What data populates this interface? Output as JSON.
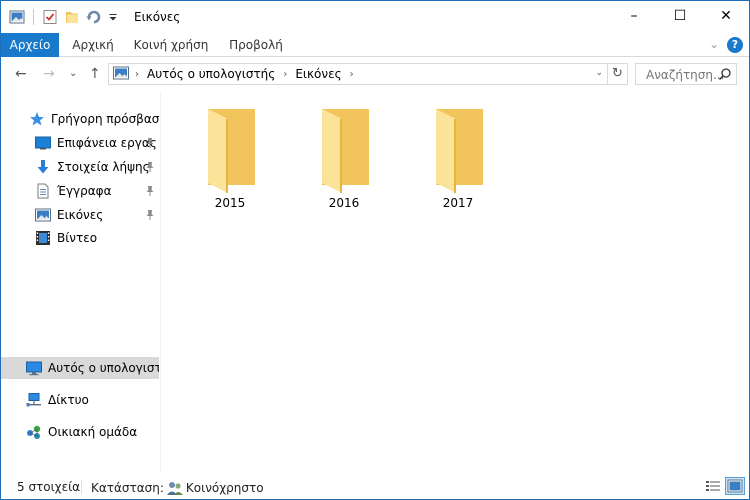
{
  "window": {
    "title": "Εικόνες",
    "minimize": "–",
    "maximize": "☐",
    "close": "✕"
  },
  "ribbon": {
    "tabs": [
      {
        "label": "Αρχείο",
        "active": true
      },
      {
        "label": "Αρχική"
      },
      {
        "label": "Κοινή χρήση"
      },
      {
        "label": "Προβολή"
      }
    ],
    "collapse_glyph": "⌄",
    "help_glyph": "?"
  },
  "nav": {
    "back": "←",
    "forward": "→",
    "recent": "⌄",
    "up": "↑",
    "breadcrumb": [
      {
        "label": "Αυτός ο υπολογιστής"
      },
      {
        "label": "Εικόνες"
      }
    ],
    "crumb_sep": "›",
    "refresh": "↻",
    "search_placeholder": "Αναζήτηση..."
  },
  "sidebar": {
    "items": [
      {
        "label": "Γρήγορη πρόσβαση",
        "icon": "star-icon",
        "pinned": false
      },
      {
        "label": "Επιφάνεια εργας",
        "icon": "desktop-icon",
        "pinned": true
      },
      {
        "label": "Στοιχεία λήψης",
        "icon": "download-icon",
        "pinned": true
      },
      {
        "label": "Έγγραφα",
        "icon": "documents-icon",
        "pinned": true
      },
      {
        "label": "Εικόνες",
        "icon": "pictures-icon",
        "pinned": true
      },
      {
        "label": "Βίντεο",
        "icon": "videos-icon",
        "pinned": false
      },
      {
        "label": "Αυτός ο υπολογιστ",
        "icon": "this-pc-icon",
        "selected": true
      },
      {
        "label": "Δίκτυο",
        "icon": "network-icon"
      },
      {
        "label": "Οικιακή ομάδα",
        "icon": "homegroup-icon"
      }
    ]
  },
  "content": {
    "folders": [
      {
        "name": "2015"
      },
      {
        "name": "2016"
      },
      {
        "name": "2017"
      }
    ]
  },
  "status": {
    "item_count": "5 στοιχεία",
    "state_label": "Κατάσταση:",
    "state_value": "Κοινόχρηστο"
  },
  "colors": {
    "accent": "#1979ca",
    "folder_back": "#f2c55c",
    "folder_front": "#fbe49a"
  }
}
